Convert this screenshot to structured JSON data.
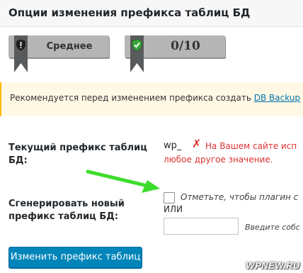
{
  "header": {
    "title": "Опции изменения префикса таблиц БД"
  },
  "badges": [
    {
      "label": "Среднее",
      "icon": "shield-warning-icon"
    },
    {
      "label": "0/10",
      "icon": "shield-check-icon"
    }
  ],
  "notice": {
    "text": "Рекомендуется перед изменением префикса создать ",
    "link": "DB Backup"
  },
  "current_prefix": {
    "label_line1": "Текущий префикс таблиц",
    "label_line2": "БД:",
    "value": "wp_",
    "error_line1": "На Вашем сайте исп",
    "error_line2": "любое другое значение."
  },
  "generate": {
    "label_line1": "Сгенерировать новый",
    "label_line2": "префикс таблиц БД:",
    "checkbox_note": "Отметьте, чтобы плагин с",
    "or_text": "ИЛИ",
    "input_value": "",
    "input_note": "Введите собс"
  },
  "submit": {
    "label": "Изменить префикс таблиц"
  },
  "watermark": "WPNEW.RU",
  "colors": {
    "accent": "#0085ba",
    "error": "#dc3232",
    "notice_border": "#ffb900",
    "arrow": "#3ddc2c"
  }
}
